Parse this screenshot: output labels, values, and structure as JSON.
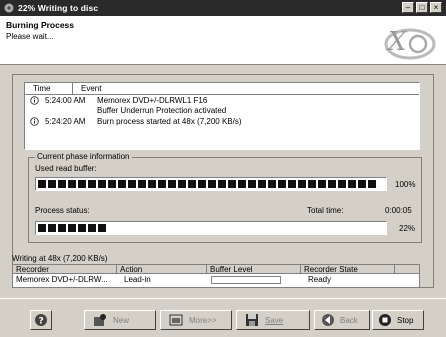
{
  "window": {
    "title": "22% Writing to disc"
  },
  "header": {
    "title": "Burning Process",
    "subtitle": "Please wait..."
  },
  "log": {
    "columns": [
      "Time",
      "Event"
    ],
    "rows": [
      {
        "icon": "info-icon",
        "time": "5:24:00 AM",
        "event": "Memorex DVD+/-DLRWL1 F16"
      },
      {
        "icon": "",
        "time": "",
        "event": "Buffer Underrun Protection activated"
      },
      {
        "icon": "info-icon",
        "time": "5:24:20 AM",
        "event": "Burn process started at 48x (7,200 KB/s)"
      }
    ]
  },
  "phase": {
    "legend": "Current phase information",
    "read_buffer_label": "Used read buffer:",
    "read_buffer_percent": "100%",
    "read_buffer_value": 1.0,
    "process_label": "Process status:",
    "total_time_label": "Total time:",
    "total_time_value": "0:00:05",
    "process_percent": "22%",
    "process_value": 0.22
  },
  "status_line": "Writing at 48x (7,200 KB/s)",
  "recorders": {
    "columns": [
      "Recorder",
      "Action",
      "Buffer Level",
      "Recorder State"
    ],
    "rows": [
      {
        "recorder": "Memorex DVD+/-DLRW...",
        "action": "Lead-in",
        "buffer_level": 0.0,
        "state": "Ready"
      }
    ]
  },
  "buttons": {
    "help": "",
    "new": "New",
    "more": "More>>",
    "save": "Save",
    "back": "Back",
    "stop": "Stop"
  },
  "colors": {
    "titlebar": "#2a2a2a",
    "progress_fill": "#111111",
    "face": "#d4d0c8"
  }
}
